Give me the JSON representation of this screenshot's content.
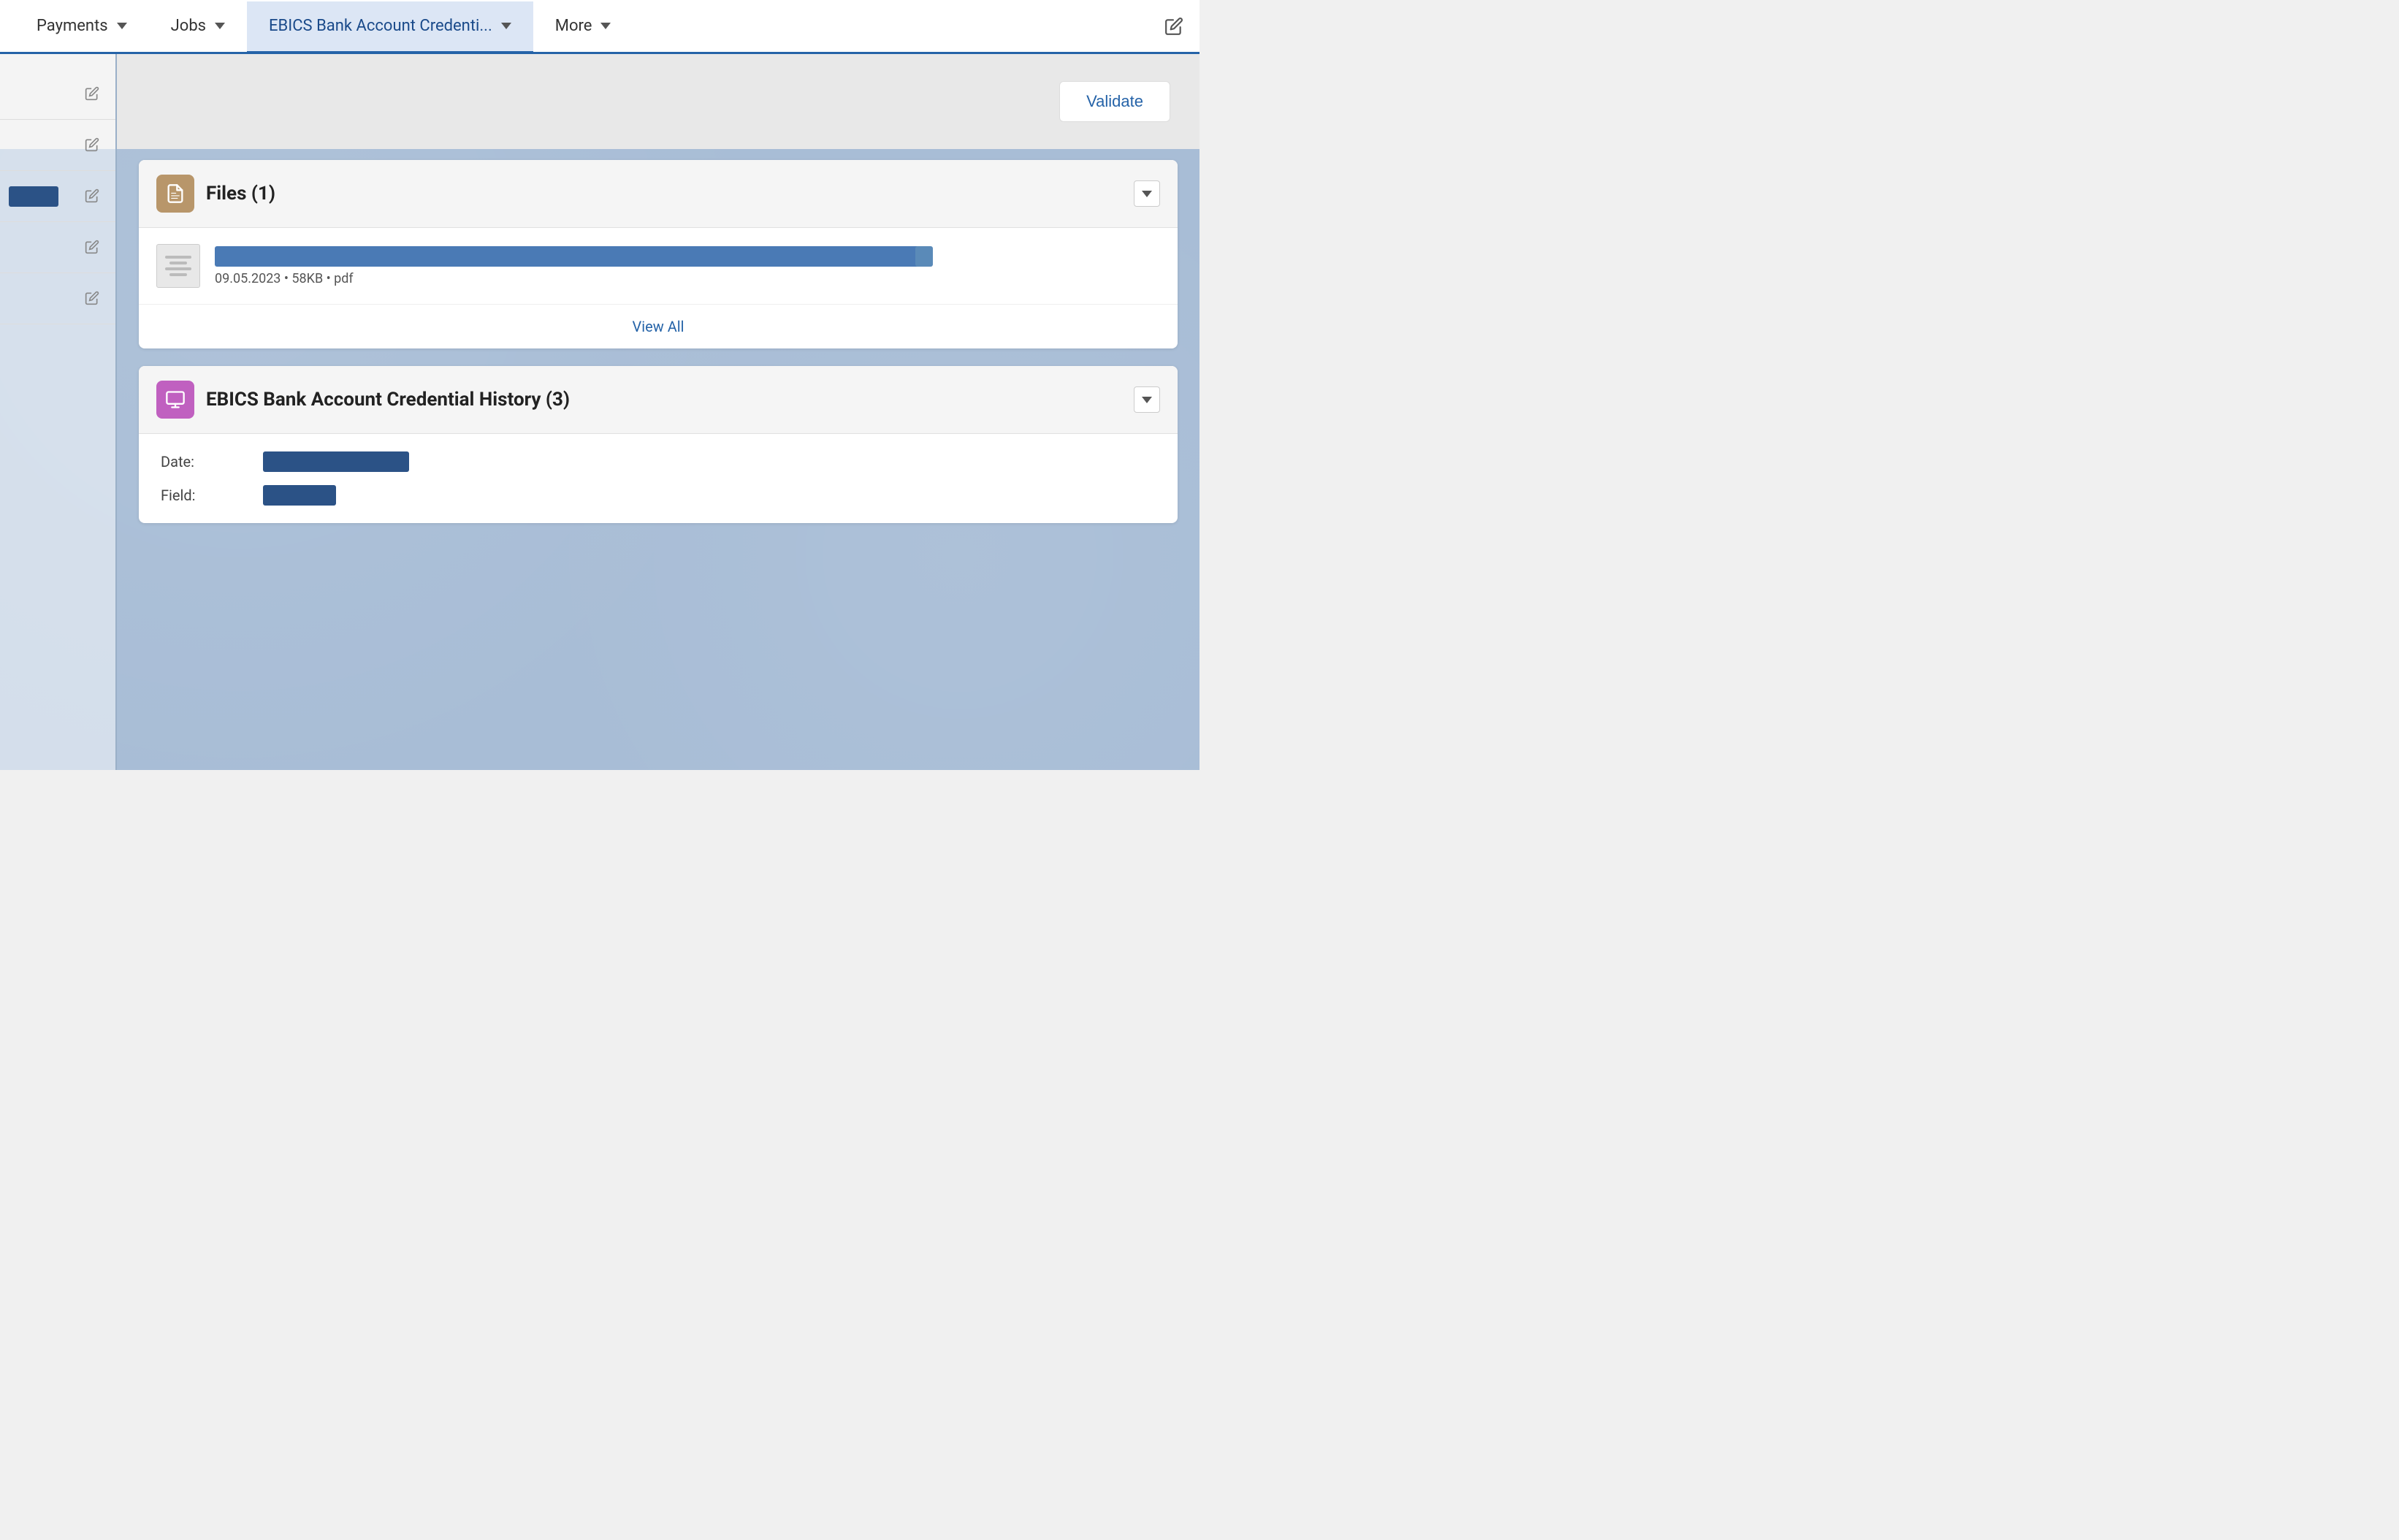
{
  "nav": {
    "items": [
      {
        "id": "payments",
        "label": "Payments",
        "hasChevron": true,
        "active": false
      },
      {
        "id": "jobs",
        "label": "Jobs",
        "hasChevron": true,
        "active": false
      },
      {
        "id": "ebics",
        "label": "EBICS Bank Account Credenti...",
        "hasChevron": true,
        "active": true
      },
      {
        "id": "more",
        "label": "More",
        "hasChevron": true,
        "active": false
      }
    ]
  },
  "toolbar": {
    "validate_label": "Validate"
  },
  "files_card": {
    "title": "Files (1)",
    "file": {
      "date": "09.05.2023",
      "size": "58KB",
      "type": "pdf",
      "meta": "09.05.2023 • 58KB • pdf"
    },
    "view_all_label": "View All"
  },
  "history_card": {
    "title": "EBICS Bank Account Credential History (3)",
    "fields": [
      {
        "label": "Date:",
        "bar_width": "wide"
      },
      {
        "label": "Field:",
        "bar_width": "narrow"
      }
    ]
  },
  "icons": {
    "files": "📋",
    "history": "🖥",
    "edit_pencil": "✏",
    "chevron_down": "▼"
  }
}
